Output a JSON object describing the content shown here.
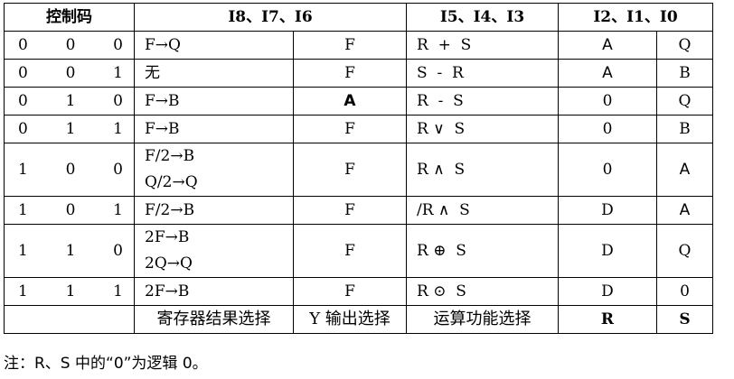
{
  "headers": {
    "control_code": "控制码",
    "group_a": "I8、I7、I6",
    "group_b": "I5、I4、I3",
    "group_c": "I2、I1、I0"
  },
  "rows": [
    {
      "bits": [
        "0",
        "0",
        "0"
      ],
      "reg": [
        "F→Q"
      ],
      "y": "F",
      "alu": "R  +  S",
      "r": "A",
      "s": "Q"
    },
    {
      "bits": [
        "0",
        "0",
        "1"
      ],
      "reg": [
        "无"
      ],
      "y": "F",
      "alu": "S  -  R",
      "r": "A",
      "s": "B"
    },
    {
      "bits": [
        "0",
        "1",
        "0"
      ],
      "reg": [
        "F→B"
      ],
      "y": "A",
      "alu": "R  -  S",
      "r": "0",
      "s": "Q"
    },
    {
      "bits": [
        "0",
        "1",
        "1"
      ],
      "reg": [
        "F→B"
      ],
      "y": "F",
      "alu": "R ∨  S",
      "r": "0",
      "s": "B"
    },
    {
      "bits": [
        "1",
        "0",
        "0"
      ],
      "reg": [
        "F/2→B",
        "Q/2→Q"
      ],
      "y": "F",
      "alu": "R ∧  S",
      "r": "0",
      "s": "A"
    },
    {
      "bits": [
        "1",
        "0",
        "1"
      ],
      "reg": [
        "F/2→B"
      ],
      "y": "F",
      "alu": "/R ∧  S",
      "r": "D",
      "s": "A"
    },
    {
      "bits": [
        "1",
        "1",
        "0"
      ],
      "reg": [
        "2F→B",
        "2Q→Q"
      ],
      "y": "F",
      "alu": "R ⊕  S",
      "r": "D",
      "s": "Q"
    },
    {
      "bits": [
        "1",
        "1",
        "1"
      ],
      "reg": [
        "2F→B"
      ],
      "y": "F",
      "alu": "R ⊙  S",
      "r": "D",
      "s": "0"
    }
  ],
  "footer": {
    "reg_select": "寄存器结果选择",
    "y_select": "Y 输出选择",
    "alu_select": "运算功能选择",
    "r_label": "R",
    "s_label": "S"
  },
  "note": "注：R、S 中的“0”为逻辑 0。"
}
